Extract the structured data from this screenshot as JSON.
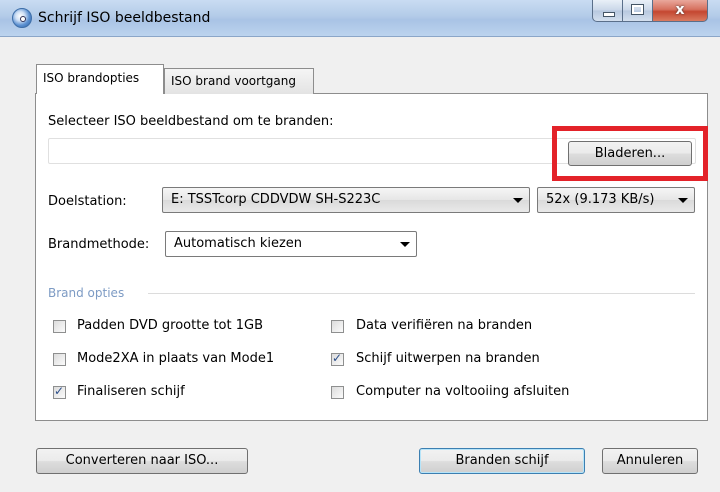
{
  "window": {
    "title": "Schrijf ISO beeldbestand",
    "close_glyph": "x"
  },
  "tabs": [
    {
      "label": "ISO brandopties",
      "selected": true
    },
    {
      "label": "ISO brand voortgang",
      "selected": false
    }
  ],
  "iso": {
    "label": "Selecteer ISO beeldbestand om te branden:",
    "path_value": "",
    "browse_label": "Bladeren...",
    "highlight_color": "#e32229"
  },
  "target": {
    "label": "Doelstation:",
    "drive_value": "E: TSSTcorp CDDVDW SH-S223C",
    "speed_value": "52x (9.173 KB/s)"
  },
  "method": {
    "label": "Brandmethode:",
    "value": "Automatisch kiezen"
  },
  "options": {
    "group_label": "Brand opties",
    "left": [
      {
        "label": "Padden DVD grootte tot 1GB",
        "checked": false
      },
      {
        "label": "Mode2XA in plaats van Mode1",
        "checked": false
      },
      {
        "label": "Finaliseren schijf",
        "checked": true
      }
    ],
    "right": [
      {
        "label": "Data verifiëren na branden",
        "checked": false
      },
      {
        "label": "Schijf uitwerpen na branden",
        "checked": true
      },
      {
        "label": "Computer na voltooiing afsluiten",
        "checked": false
      }
    ]
  },
  "footer": {
    "convert_label": "Converteren naar ISO...",
    "burn_label": "Branden schijf",
    "cancel_label": "Annuleren"
  }
}
